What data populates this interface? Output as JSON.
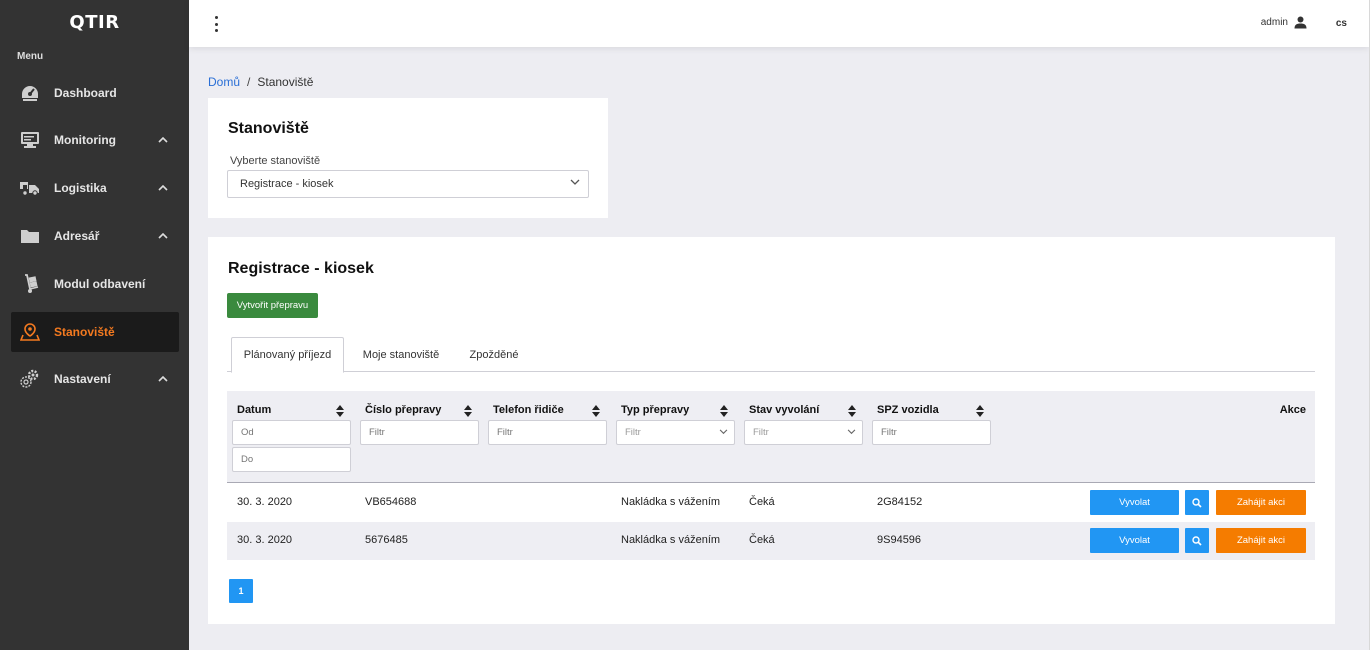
{
  "sidebar": {
    "logo": "QTIR",
    "menu_label": "Menu",
    "items": [
      {
        "label": "Dashboard",
        "icon": "dashboard-icon",
        "has_chevron": false
      },
      {
        "label": "Monitoring",
        "icon": "monitor-icon",
        "has_chevron": true
      },
      {
        "label": "Logistika",
        "icon": "truck-icon",
        "has_chevron": true
      },
      {
        "label": "Adresář",
        "icon": "folder-icon",
        "has_chevron": true
      },
      {
        "label": "Modul odbavení",
        "icon": "hand-truck-icon",
        "has_chevron": false
      },
      {
        "label": "Stanoviště",
        "icon": "location-icon",
        "has_chevron": false,
        "active": true
      },
      {
        "label": "Nastavení",
        "icon": "gear-icon",
        "has_chevron": true
      }
    ]
  },
  "topbar": {
    "user": "admin",
    "lang": "cs"
  },
  "breadcrumb": {
    "home": "Domů",
    "separator": "/",
    "current": "Stanoviště"
  },
  "station_card": {
    "title": "Stanoviště",
    "field_label": "Vyberte stanoviště",
    "selected": "Registrace - kiosek"
  },
  "main_card": {
    "title": "Registrace - kiosek",
    "create_button": "Vytvořit přepravu",
    "tabs": [
      "Plánovaný příjezd",
      "Moje stanoviště",
      "Zpožděné"
    ],
    "active_tab": 0
  },
  "table": {
    "columns": [
      "Datum",
      "Číslo přepravy",
      "Telefon řidiče",
      "Typ přepravy",
      "Stav vyvolání",
      "SPZ vozidla",
      "Akce"
    ],
    "filters": {
      "date_from": "Od",
      "date_to": "Do",
      "generic": "Filtr"
    },
    "rows": [
      {
        "datum": "30. 3. 2020",
        "cislo": "VB654688",
        "telefon": "",
        "typ": "Nakládka s vážením",
        "stav": "Čeká",
        "spz": "2G84152"
      },
      {
        "datum": "30. 3. 2020",
        "cislo": "5676485",
        "telefon": "",
        "typ": "Nakládka s vážením",
        "stav": "Čeká",
        "spz": "9S94596"
      }
    ],
    "actions": {
      "call": "Vyvolat",
      "start": "Zahájit akci"
    }
  },
  "pagination": {
    "current_page": "1"
  },
  "colors": {
    "sidebar_bg": "#333333",
    "active_accent": "#f47a20",
    "green_button": "#3a8a3e",
    "blue_button": "#2196f3",
    "orange_button": "#f57c00",
    "link": "#2a6fd6"
  }
}
